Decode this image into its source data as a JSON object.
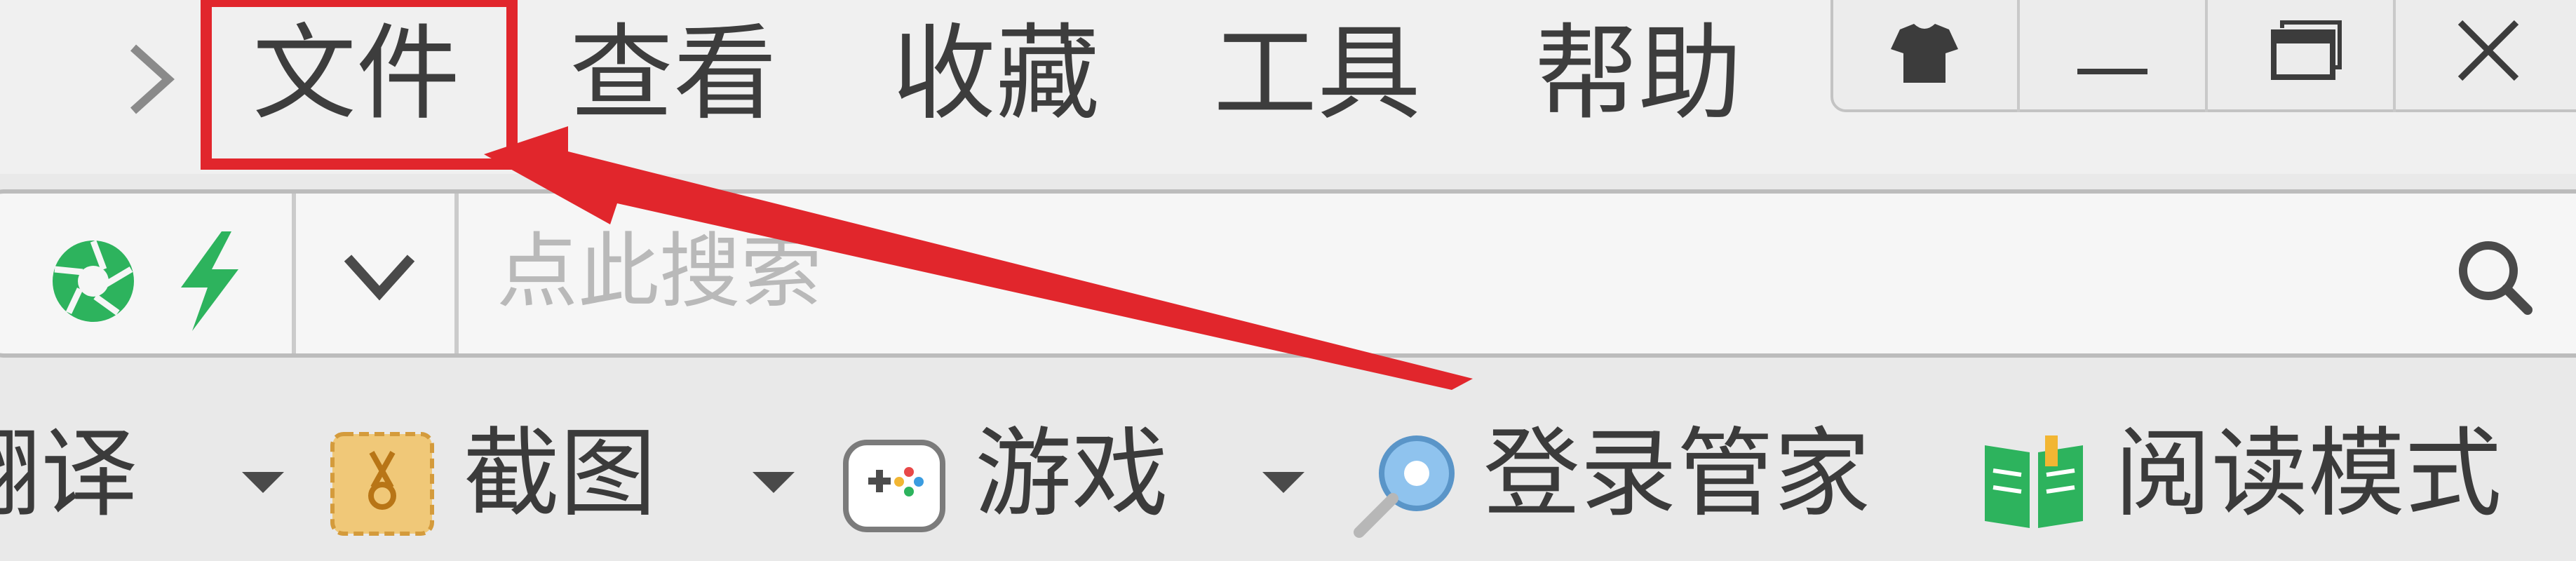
{
  "menu": {
    "items": [
      "文件",
      "查看",
      "收藏",
      "工具",
      "帮助"
    ]
  },
  "window_controls": {
    "skin_icon": "tshirt-icon",
    "minimize_icon": "minimize-icon",
    "maximize_icon": "maximize-icon",
    "close_icon": "close-icon"
  },
  "search": {
    "placeholder": "点此搜索",
    "engine_icon": "shutter-icon",
    "speed_icon": "lightning-icon",
    "dropdown_icon": "chevron-down-icon",
    "search_icon": "search-icon"
  },
  "toolbar": {
    "translate_label": "翻译",
    "screenshot_label": "截图",
    "game_label": "游戏",
    "login_label": "登录管家",
    "reading_label": "阅读模式"
  },
  "colors": {
    "highlight": "#e1262c",
    "green": "#2db35d"
  }
}
